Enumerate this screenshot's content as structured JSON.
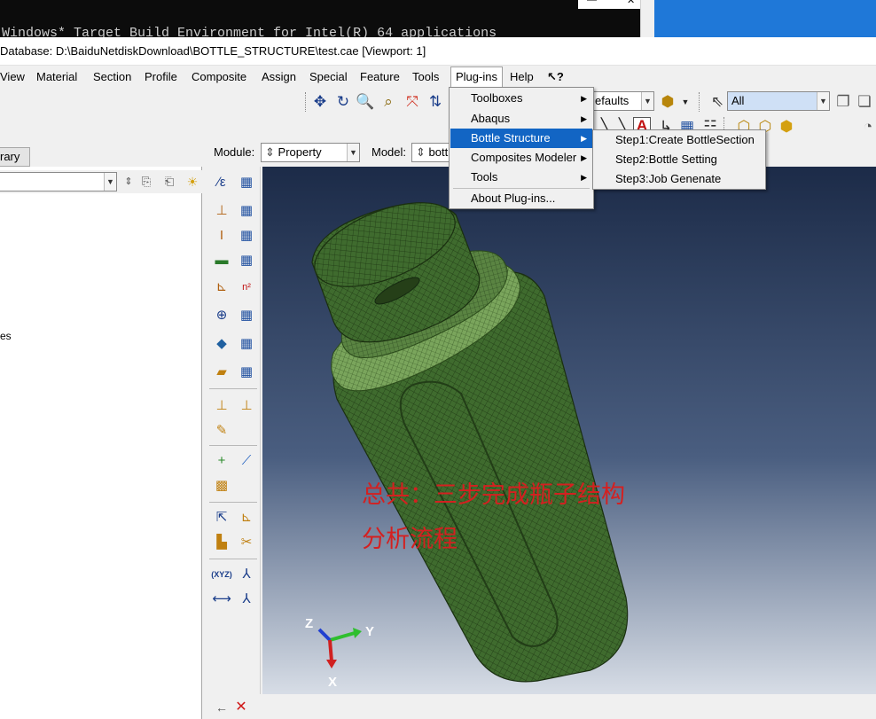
{
  "terminal": {
    "text": "Windows* Target Build Environment for Intel(R) 64 applications",
    "min_glyph": "—",
    "close_glyph": "✕"
  },
  "window": {
    "title": "Database: D:\\BaiduNetdiskDownload\\BOTTLE_STRUCTURE\\test.cae [Viewport: 1]"
  },
  "menubar": {
    "items": [
      "View",
      "Material",
      "Section",
      "Profile",
      "Composite",
      "Assign",
      "Special",
      "Feature",
      "Tools",
      "Plug-ins",
      "Help"
    ],
    "help_cursor": "↖?"
  },
  "toolbar": {
    "defaults_combo": "efaults",
    "selection_combo": "All"
  },
  "left_panel": {
    "tab_label": "rary",
    "tree_fragment": "es"
  },
  "module_row": {
    "module_label": "Module:",
    "module_value": "Property",
    "model_label": "Model:",
    "model_value": "bottl"
  },
  "plugins_menu": {
    "items": [
      {
        "label": "Toolboxes",
        "has_submenu": true
      },
      {
        "label": "Abaqus",
        "has_submenu": true
      },
      {
        "label": "Bottle Structure",
        "has_submenu": true,
        "highlighted": true
      },
      {
        "label": "Composites Modeler",
        "has_submenu": true
      },
      {
        "label": "Tools",
        "has_submenu": true
      },
      {
        "label": "About Plug-ins...",
        "has_submenu": false
      }
    ]
  },
  "bottle_submenu": {
    "items": [
      "Step1:Create BottleSection",
      "Step2:Bottle Setting",
      "Step3:Job Genenate"
    ]
  },
  "viewport": {
    "annotation_line1": "总共：三步完成瓶子结构",
    "annotation_line2": "分析流程",
    "triad": {
      "z": "Z",
      "y": "Y",
      "x": "X"
    }
  },
  "colors": {
    "menu_highlight": "#1265c4",
    "annotation": "#d42020",
    "mesh_green": "#3f6b2e",
    "desktop_blue": "#1f78d8"
  },
  "icons": {
    "back": "←",
    "close": "✕"
  }
}
